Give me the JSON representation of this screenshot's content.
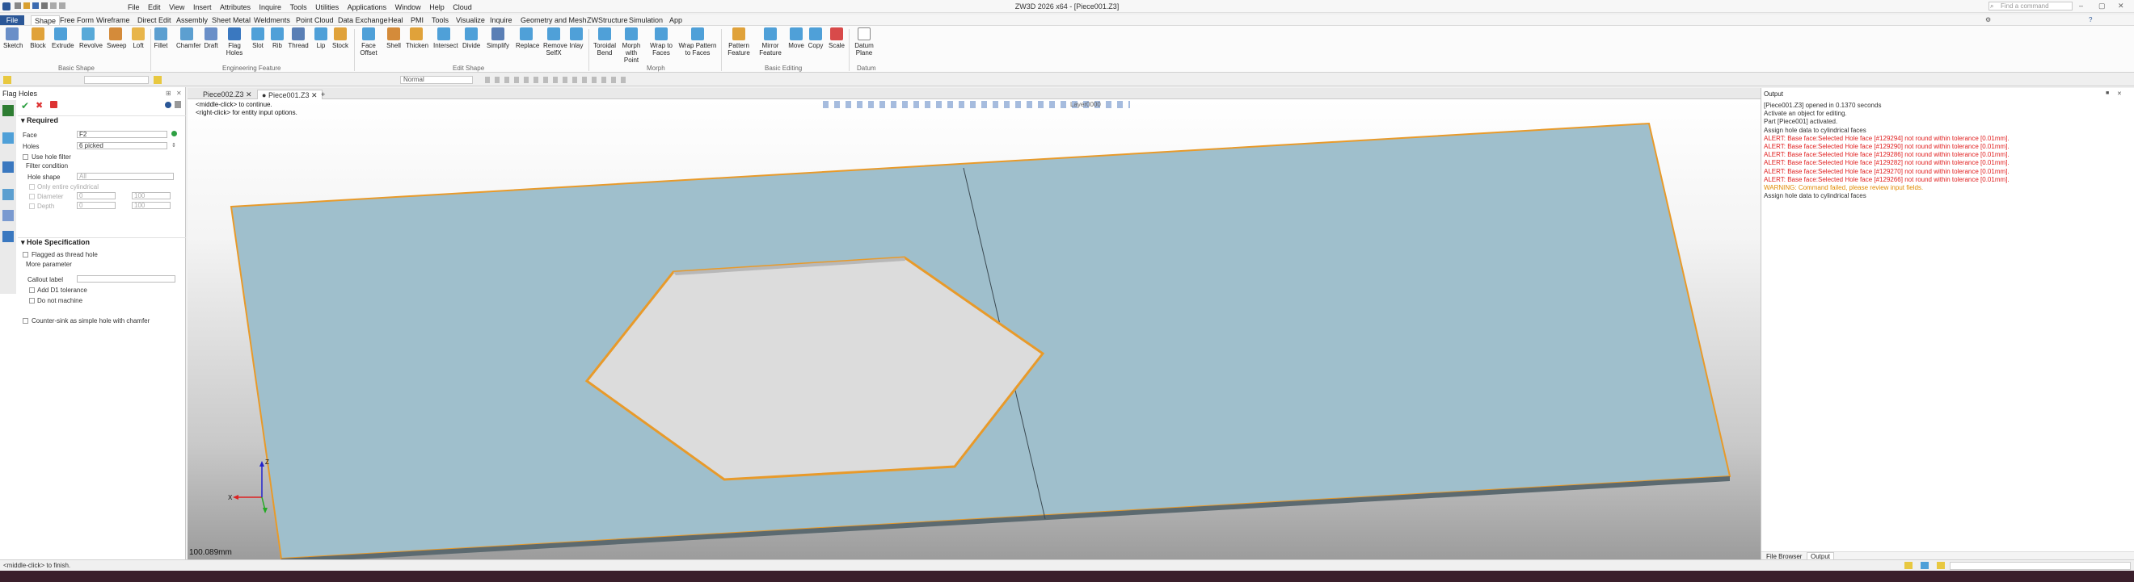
{
  "app_title": "ZW3D 2026 x64 - [Piece001.Z3]",
  "menu": [
    "File",
    "Edit",
    "View",
    "Insert",
    "Attributes",
    "Inquire",
    "Tools",
    "Utilities",
    "Applications",
    "Window",
    "Help",
    "Cloud"
  ],
  "ribbon_tabs": [
    "File",
    "Shape",
    "Free Form",
    "Wireframe",
    "Direct Edit",
    "Assembly",
    "Sheet Metal",
    "Weldments",
    "Point Cloud",
    "Data Exchange",
    "Heal",
    "PMI",
    "Tools",
    "Visualize",
    "Inquire",
    "Geometry and Mesh",
    "ZWStructure",
    "Simulation",
    "App"
  ],
  "search_placeholder": "Find a command",
  "ribbon": {
    "basic_shape": [
      "Sketch",
      "Block",
      "Extrude",
      "Revolve",
      "Sweep",
      "Loft"
    ],
    "engineering": [
      "Fillet",
      "Chamfer",
      "Draft",
      "Flag Holes",
      "Slot",
      "Rib",
      "Thread",
      "Lip",
      "Stock"
    ],
    "edit_shape": [
      "Face Offset",
      "Shell",
      "Thicken",
      "Intersect",
      "Divide",
      "Simplify",
      "Replace",
      "Remove SelfX",
      "Inlay"
    ],
    "morph": [
      "Toroidal Bend",
      "Morph with Point",
      "Wrap to Faces",
      "Wrap Pattern to Faces"
    ],
    "basic_editing": [
      "Pattern Feature",
      "Mirror Feature",
      "Move",
      "Copy",
      "Scale"
    ],
    "datum": [
      "Datum Plane"
    ],
    "groups": {
      "basic_shape": "Basic Shape",
      "engineering": "Engineering Feature",
      "edit_shape": "Edit Shape",
      "morph": "Morph",
      "basic_editing": "Basic Editing",
      "datum": "Datum"
    }
  },
  "quick_toolbar": {
    "style_select": "Normal",
    "layer": "Layer0000"
  },
  "left_panel": {
    "title": "Flag Holes",
    "required": "Required",
    "face_label": "Face",
    "face_value": "F2",
    "holes_label": "Holes",
    "holes_value": "6 picked",
    "use_hole_filter": "Use hole filter",
    "filter_condition": "Filter condition",
    "hole_shape_label": "Hole shape",
    "hole_shape_value": "All",
    "only_cylindrical": "Only entire cylindrical",
    "diameter_label": "Diameter",
    "diameter_min": "0",
    "diameter_max": "100",
    "depth_label": "Depth",
    "depth_min": "0",
    "depth_max": "100",
    "hole_spec": "Hole Specification",
    "flagged_thread": "Flagged as thread hole",
    "more_param": "More parameter",
    "callout_label": "Callout label",
    "add_d1": "Add D1 tolerance",
    "do_not_machine": "Do not machine",
    "counter_sink": "Counter-sink as simple hole with chamfer"
  },
  "doc_tabs": [
    "Piece002.Z3",
    "Piece001.Z3"
  ],
  "viewport": {
    "hint1": "<middle-click> to continue.",
    "hint2": "<right-click> for entity input options.",
    "scale_readout": "100.089mm",
    "axis_x": "X",
    "axis_z": "Z"
  },
  "output": {
    "title": "Output",
    "lines": [
      {
        "text": "[Piece001.Z3] opened in 0.1370 seconds",
        "color": "#333333"
      },
      {
        "text": "Activate an object for editing.",
        "color": "#333333"
      },
      {
        "text": "Part [Piece001] activated.",
        "color": "#333333"
      },
      {
        "text": "Assign hole data to cylindrical faces",
        "color": "#333333"
      },
      {
        "text": "ALERT: Base face:Selected Hole face [#129294] not round within tolerance [0.01mm].",
        "color": "#e02020"
      },
      {
        "text": "ALERT: Base face:Selected Hole face [#129290] not round within tolerance [0.01mm].",
        "color": "#e02020"
      },
      {
        "text": "ALERT: Base face:Selected Hole face [#129286] not round within tolerance [0.01mm].",
        "color": "#e02020"
      },
      {
        "text": "ALERT: Base face:Selected Hole face [#129282] not round within tolerance [0.01mm].",
        "color": "#e02020"
      },
      {
        "text": "ALERT: Base face:Selected Hole face [#129270] not round within tolerance [0.01mm].",
        "color": "#e02020"
      },
      {
        "text": "ALERT: Base face:Selected Hole face [#129266] not round within tolerance [0.01mm].",
        "color": "#e02020"
      },
      {
        "text": "WARNING: Command failed, please review input fields.",
        "color": "#e08a00"
      },
      {
        "text": "Assign hole data to cylindrical faces",
        "color": "#333333"
      }
    ],
    "bottom_tabs": [
      "File Browser",
      "Output"
    ]
  },
  "status_text": "<middle-click> to finish.",
  "colors": {
    "accent": "#2b5797",
    "plate": "#9fbfcc",
    "edge": "#e89a2a"
  }
}
